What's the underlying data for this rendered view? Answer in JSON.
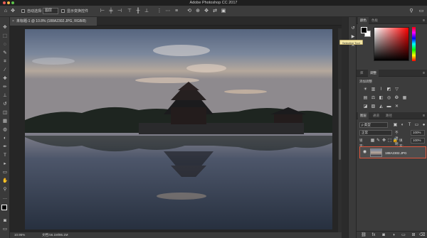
{
  "window": {
    "title": "Adobe Photoshop CC 2017",
    "traffic_colors": [
      "#ec5f57",
      "#f3b946",
      "#5cc34b"
    ]
  },
  "options_bar": {
    "auto_select_label": "自动选择:",
    "auto_select_value": "图层",
    "show_transform_label": "显示变换控件"
  },
  "document": {
    "tab_title": "未标题-1 @ 10.8% (188A2302.JPG, RGB/8)",
    "close_glyph": "×",
    "zoom": "10.95%",
    "doc_size": "文档:56.1M/86.1M"
  },
  "color_panel": {
    "tabs": [
      "颜色",
      "色板"
    ],
    "tooltip": "Selective Tool"
  },
  "adjustments_panel": {
    "tabs": [
      "库",
      "调整"
    ],
    "add_label": "添加调整"
  },
  "layers_panel": {
    "tabs": [
      "图层",
      "通道",
      "路径"
    ],
    "filter_label": "ρ 类型",
    "blend_mode": "正常",
    "opacity_label": "不透明度:",
    "opacity_value": "100%",
    "lock_label": "锁定:",
    "fill_label": "填充:",
    "fill_value": "100%",
    "layer_name": "188A2302.JPG",
    "highlight_color": "#e0583e"
  },
  "icons": {
    "move": "✥",
    "marquee": "⬚",
    "lasso": "◌",
    "quick_select": "✎",
    "crop": "⌗",
    "eyedropper": "⁄",
    "heal": "✚",
    "brush": "✏",
    "stamp": "⊥",
    "history": "↺",
    "eraser": "◫",
    "gradient": "▦",
    "blur": "◍",
    "dodge": "◐",
    "pen": "✒",
    "type": "T",
    "path_select": "▸",
    "shape": "▭",
    "hand": "✋",
    "zoom": "⚲",
    "more": "…",
    "eye": "👁",
    "play": "▶",
    "menu": "≡",
    "link": "⛓",
    "fx": "fx",
    "mask": "◙",
    "adjust": "◑",
    "folder": "▭",
    "new": "⊞",
    "trash": "⌫"
  }
}
